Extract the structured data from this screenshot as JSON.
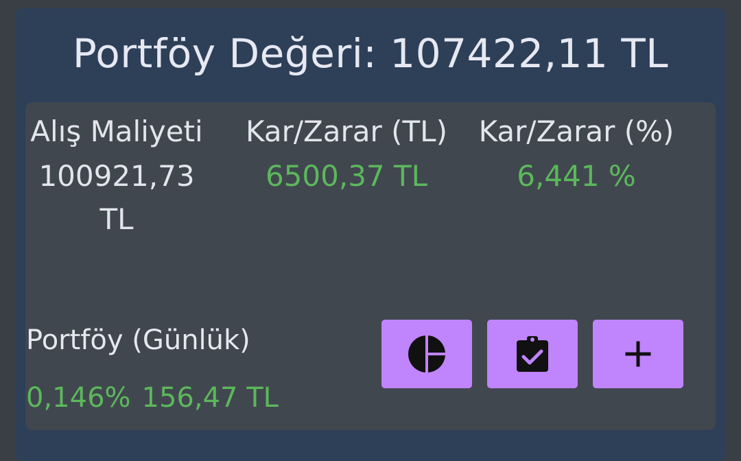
{
  "portfolio": {
    "title": "Portföy Değeri: 107422,11 TL"
  },
  "summary": {
    "cost": {
      "label": "Alış Maliyeti",
      "value": "100921,73 TL"
    },
    "profit_tl": {
      "label": "Kar/Zarar (TL)",
      "value": "6500,37 TL"
    },
    "profit_pct": {
      "label": "Kar/Zarar (%)",
      "value": "6,441 %"
    }
  },
  "daily": {
    "label": "Portföy (Günlük)",
    "percent": "0,146%",
    "amount": "156,47 TL"
  },
  "actions": [
    {
      "icon": "pie-chart-icon"
    },
    {
      "icon": "clipboard-check-icon"
    },
    {
      "icon": "plus-icon"
    }
  ],
  "colors": {
    "card_background": "#2e3f58",
    "inner_panel": "#41474f",
    "positive": "#5cb85c",
    "button": "#c084fc"
  }
}
